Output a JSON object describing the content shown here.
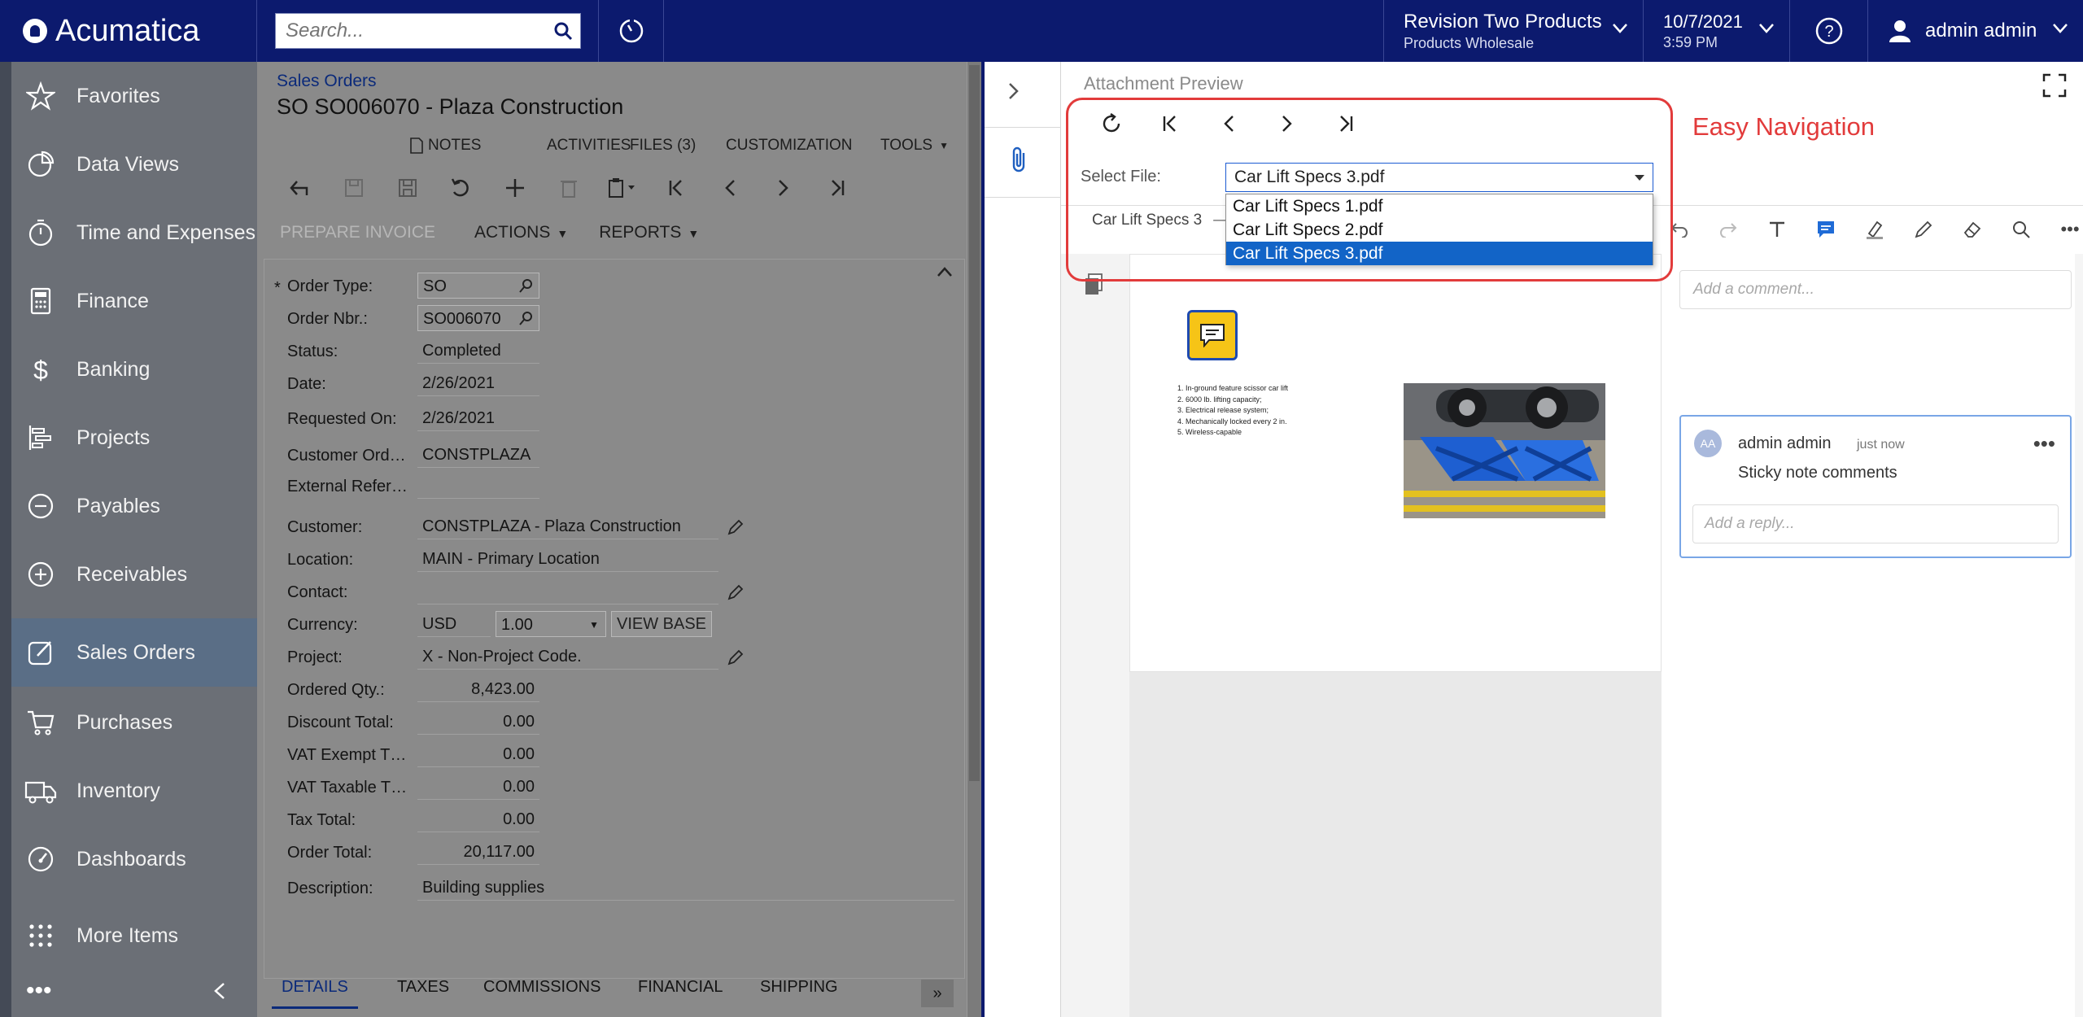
{
  "topbar": {
    "brand": "Acumatica",
    "search_placeholder": "Search...",
    "company": "Revision Two Products",
    "branch": "Products Wholesale",
    "date": "10/7/2021",
    "time": "3:59 PM",
    "user": "admin admin"
  },
  "sidebar": {
    "items": [
      {
        "label": "Favorites",
        "icon": "star-icon"
      },
      {
        "label": "Data Views",
        "icon": "pie-chart-icon"
      },
      {
        "label": "Time and Expenses",
        "icon": "stopwatch-icon"
      },
      {
        "label": "Finance",
        "icon": "calculator-icon"
      },
      {
        "label": "Banking",
        "icon": "dollar-icon"
      },
      {
        "label": "Projects",
        "icon": "gantt-icon"
      },
      {
        "label": "Payables",
        "icon": "minus-circle-icon"
      },
      {
        "label": "Receivables",
        "icon": "plus-circle-icon"
      },
      {
        "label": "Sales Orders",
        "icon": "edit-square-icon"
      },
      {
        "label": "Purchases",
        "icon": "cart-icon"
      },
      {
        "label": "Inventory",
        "icon": "truck-icon"
      },
      {
        "label": "Dashboards",
        "icon": "gauge-icon"
      },
      {
        "label": "More Items",
        "icon": "grid-icon"
      }
    ],
    "active": "Sales Orders"
  },
  "main": {
    "breadcrumb": "Sales Orders",
    "title": "SO SO006070 - Plaza Construction",
    "menu": [
      "NOTES",
      "ACTIVITIES",
      "FILES (3)",
      "CUSTOMIZATION",
      "TOOLS"
    ],
    "actions": {
      "prepare_invoice": "PREPARE INVOICE",
      "actions": "ACTIONS",
      "reports": "REPORTS"
    },
    "fields": {
      "order_type_label": "Order Type:",
      "order_type": "SO",
      "order_nbr_label": "Order Nbr.:",
      "order_nbr": "SO006070",
      "status_label": "Status:",
      "status": "Completed",
      "date_label": "Date:",
      "date": "2/26/2021",
      "requested_label": "Requested On:",
      "requested": "2/26/2021",
      "customer_ord_label": "Customer Ord…",
      "customer_ord": "CONSTPLAZA",
      "external_ref_label": "External Refer…",
      "external_ref": "",
      "customer_label": "Customer:",
      "customer": "CONSTPLAZA - Plaza Construction",
      "location_label": "Location:",
      "location": "MAIN - Primary Location",
      "contact_label": "Contact:",
      "contact": "",
      "currency_label": "Currency:",
      "currency": "USD",
      "rate": "1.00",
      "view_base": "VIEW BASE",
      "project_label": "Project:",
      "project": "X - Non-Project Code.",
      "ordered_qty_label": "Ordered Qty.:",
      "ordered_qty": "8,423.00",
      "discount_label": "Discount Total:",
      "discount": "0.00",
      "vat_exempt_label": "VAT Exempt T…",
      "vat_exempt": "0.00",
      "vat_taxable_label": "VAT Taxable T…",
      "vat_taxable": "0.00",
      "tax_label": "Tax Total:",
      "tax": "0.00",
      "order_total_label": "Order Total:",
      "order_total": "20,117.00",
      "description_label": "Description:",
      "description": "Building supplies"
    },
    "tabs": [
      "DETAILS",
      "TAXES",
      "COMMISSIONS",
      "FINANCIAL",
      "SHIPPING"
    ]
  },
  "preview": {
    "title": "Attachment Preview",
    "highlight_label": "Easy Navigation",
    "select_label": "Select File:",
    "selected_file": "Car Lift Specs 3.pdf",
    "files": [
      "Car Lift Specs 1.pdf",
      "Car Lift Specs 2.pdf",
      "Car Lift Specs 3.pdf"
    ],
    "doc_tab": "Car Lift Specs 3",
    "doc_list": [
      "1.  In-ground feature scissor car lift",
      "2.  6000 lb. lifting capacity;",
      "3.  Electrical release system;",
      "4.  Mechanically locked every 2 in.",
      "5.  Wireless-capable"
    ],
    "add_comment_placeholder": "Add a comment...",
    "comment": {
      "avatar": "AA",
      "user": "admin admin",
      "time": "just now",
      "text": "Sticky note comments"
    },
    "reply_placeholder": "Add a reply..."
  },
  "colors": {
    "topbar": "#0c1a6e",
    "accent": "#1264c7",
    "highlight": "#e23b3b",
    "sticky": "#f6c417"
  }
}
